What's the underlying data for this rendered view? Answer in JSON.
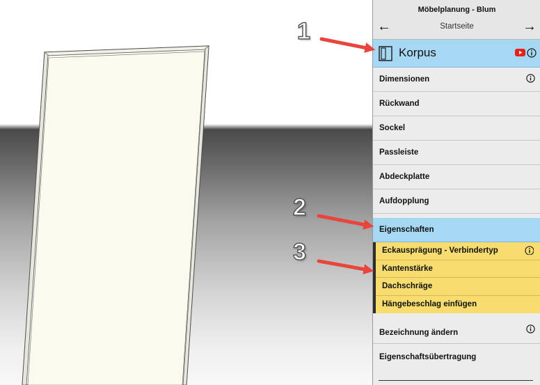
{
  "app": {
    "title": "Möbelplanung - Blum"
  },
  "nav": {
    "back": "←",
    "title": "Startseite",
    "forward": "→"
  },
  "korpus": {
    "label": "Korpus",
    "icon": "cabinet-icon",
    "video_icon": "youtube-icon",
    "info_icon": "info-icon"
  },
  "menu": {
    "dimensionen": "Dimensionen",
    "rueckwand": "Rückwand",
    "sockel": "Sockel",
    "passleiste": "Passleiste",
    "abdeckplatte": "Abdeckplatte",
    "aufdopplung": "Aufdopplung",
    "eigenschaften": "Eigenschaften",
    "bezeichnung": "Bezeichnung ändern",
    "uebertragung": "Eigenschaftsübertragung"
  },
  "submenu": {
    "eckauspraegung": "Eckausprägung - Verbindertyp",
    "kantenstaerke": "Kantenstärke",
    "dachschraege": "Dachschräge",
    "haengebeschlag": "Hängebeschlag einfügen"
  },
  "annotations": {
    "n1": "1",
    "n2": "2",
    "n3": "3"
  },
  "colors": {
    "active": "#a6d8f4",
    "submenu": "#f7dc6f",
    "arrow": "#e8453c",
    "youtube": "#e62117"
  }
}
